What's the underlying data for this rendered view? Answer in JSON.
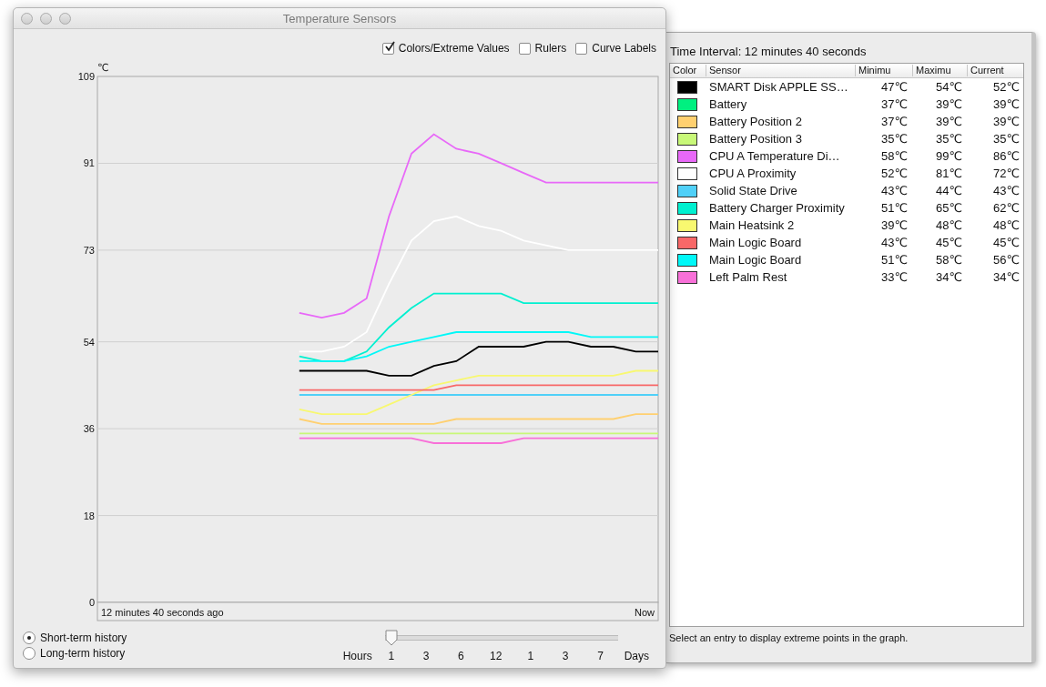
{
  "window": {
    "title": "Temperature Sensors"
  },
  "options": [
    {
      "label": "Colors/Extreme Values",
      "checked": true
    },
    {
      "label": "Rulers",
      "checked": false
    },
    {
      "label": "Curve Labels",
      "checked": false
    }
  ],
  "graph": {
    "unit": "℃",
    "start_label": "12 minutes 40 seconds ago",
    "end_label": "Now",
    "chart_data": {
      "type": "line",
      "grid": true,
      "ylim": [
        0,
        109
      ],
      "yticks": [
        0,
        18,
        36,
        54,
        73,
        91,
        109
      ],
      "series": [
        {
          "color": "#000000",
          "values": [
            null,
            null,
            null,
            null,
            null,
            null,
            null,
            null,
            null,
            48,
            48,
            48,
            48,
            47,
            47,
            49,
            50,
            53,
            53,
            53,
            54,
            54,
            53,
            53,
            52,
            52
          ]
        },
        {
          "color": "#ffd070",
          "values": [
            null,
            null,
            null,
            null,
            null,
            null,
            null,
            null,
            null,
            38,
            37,
            37,
            37,
            37,
            37,
            37,
            38,
            38,
            38,
            38,
            38,
            38,
            38,
            38,
            39,
            39
          ]
        },
        {
          "color": "#c8f878",
          "values": [
            null,
            null,
            null,
            null,
            null,
            null,
            null,
            null,
            null,
            35,
            35,
            35,
            35,
            35,
            35,
            35,
            35,
            35,
            35,
            35,
            35,
            35,
            35,
            35,
            35,
            35
          ]
        },
        {
          "color": "#e868f8",
          "values": [
            null,
            null,
            null,
            null,
            null,
            null,
            null,
            null,
            null,
            60,
            59,
            60,
            63,
            80,
            93,
            97,
            94,
            93,
            91,
            89,
            87,
            87,
            87,
            87,
            87,
            87
          ]
        },
        {
          "color": "#ffffff",
          "values": [
            null,
            null,
            null,
            null,
            null,
            null,
            null,
            null,
            null,
            52,
            52,
            53,
            56,
            66,
            75,
            79,
            80,
            78,
            77,
            75,
            74,
            73,
            73,
            73,
            73,
            73
          ]
        },
        {
          "color": "#50d0f8",
          "values": [
            null,
            null,
            null,
            null,
            null,
            null,
            null,
            null,
            null,
            43,
            43,
            43,
            43,
            43,
            43,
            43,
            43,
            43,
            43,
            43,
            43,
            43,
            43,
            43,
            43,
            43
          ]
        },
        {
          "color": "#00f0d0",
          "values": [
            null,
            null,
            null,
            null,
            null,
            null,
            null,
            null,
            null,
            51,
            50,
            50,
            52,
            57,
            61,
            64,
            64,
            64,
            64,
            62,
            62,
            62,
            62,
            62,
            62,
            62
          ]
        },
        {
          "color": "#f8f870",
          "values": [
            null,
            null,
            null,
            null,
            null,
            null,
            null,
            null,
            null,
            40,
            39,
            39,
            39,
            41,
            43,
            45,
            46,
            47,
            47,
            47,
            47,
            47,
            47,
            47,
            48,
            48
          ]
        },
        {
          "color": "#f86868",
          "values": [
            null,
            null,
            null,
            null,
            null,
            null,
            null,
            null,
            null,
            44,
            44,
            44,
            44,
            44,
            44,
            44,
            45,
            45,
            45,
            45,
            45,
            45,
            45,
            45,
            45,
            45
          ]
        },
        {
          "color": "#00f8f8",
          "values": [
            null,
            null,
            null,
            null,
            null,
            null,
            null,
            null,
            null,
            50,
            50,
            50,
            51,
            53,
            54,
            55,
            56,
            56,
            56,
            56,
            56,
            56,
            55,
            55,
            55,
            55
          ]
        },
        {
          "color": "#f870d8",
          "values": [
            null,
            null,
            null,
            null,
            null,
            null,
            null,
            null,
            null,
            34,
            34,
            34,
            34,
            34,
            34,
            33,
            33,
            33,
            33,
            34,
            34,
            34,
            34,
            34,
            34,
            34
          ]
        }
      ]
    }
  },
  "history": [
    {
      "label": "Short-term history",
      "selected": true
    },
    {
      "label": "Long-term history",
      "selected": false
    }
  ],
  "range_slider": {
    "level": 0,
    "start_label": "Hours",
    "end_label": "Days",
    "ticks": [
      "1",
      "3",
      "6",
      "12",
      "1",
      "3",
      "7"
    ]
  },
  "drawer": {
    "time_interval": "Time Interval: 12 minutes 40 seconds",
    "columns": [
      "Color",
      "Sensor",
      "Minimu",
      "Maximu",
      "Current"
    ],
    "rows": [
      {
        "color": "#000000",
        "sensor": "SMART Disk APPLE SS…",
        "min": "47℃",
        "max": "54℃",
        "current": "52℃"
      },
      {
        "color": "#00f080",
        "sensor": "Battery",
        "min": "37℃",
        "max": "39℃",
        "current": "39℃"
      },
      {
        "color": "#ffd070",
        "sensor": "Battery Position 2",
        "min": "37℃",
        "max": "39℃",
        "current": "39℃"
      },
      {
        "color": "#c8f878",
        "sensor": "Battery Position 3",
        "min": "35℃",
        "max": "35℃",
        "current": "35℃"
      },
      {
        "color": "#e868f8",
        "sensor": "CPU A Temperature Di…",
        "min": "58℃",
        "max": "99℃",
        "current": "86℃"
      },
      {
        "color": "#ffffff",
        "sensor": "CPU A Proximity",
        "min": "52℃",
        "max": "81℃",
        "current": "72℃"
      },
      {
        "color": "#50d0f8",
        "sensor": "Solid State Drive",
        "min": "43℃",
        "max": "44℃",
        "current": "43℃"
      },
      {
        "color": "#00f0d0",
        "sensor": "Battery Charger Proximity",
        "min": "51℃",
        "max": "65℃",
        "current": "62℃"
      },
      {
        "color": "#f8f870",
        "sensor": "Main Heatsink 2",
        "min": "39℃",
        "max": "48℃",
        "current": "48℃"
      },
      {
        "color": "#f86868",
        "sensor": "Main Logic Board",
        "min": "43℃",
        "max": "45℃",
        "current": "45℃"
      },
      {
        "color": "#00f8f8",
        "sensor": "Main Logic Board",
        "min": "51℃",
        "max": "58℃",
        "current": "56℃"
      },
      {
        "color": "#f870d8",
        "sensor": "Left Palm Rest",
        "min": "33℃",
        "max": "34℃",
        "current": "34℃"
      }
    ],
    "hint": "Select an entry to display extreme points in the graph."
  }
}
